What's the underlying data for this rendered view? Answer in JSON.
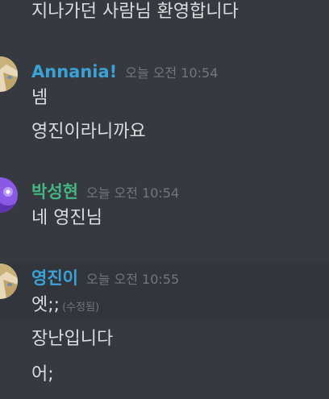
{
  "colors": {
    "background": "#36393f",
    "message_text": "#dcddde",
    "timestamp": "#72767d",
    "annania_name": "#3ba2d8",
    "park_name": "#43b581",
    "youngjin_name": "#3ba2d8"
  },
  "messages": {
    "top_line": "지나가던 사람님 환영합니다",
    "group1": {
      "username": "Annania!",
      "timestamp": "오늘 오전 10:54",
      "lines": [
        "넴",
        "영진이라니까요"
      ]
    },
    "group2": {
      "username": "박성현",
      "timestamp": "오늘 오전 10:54",
      "lines": [
        "네 영진님"
      ]
    },
    "group3": {
      "username": "영진이",
      "timestamp": "오늘 오전 10:55",
      "line1": "엣;;",
      "line1_edited": "(수정됨)",
      "line2": "장난입니다",
      "line3": "어;"
    }
  },
  "avatars": {
    "annania": "anime-girl-avatar-icon",
    "park": "purple-avatar-icon",
    "youngjin": "anime-girl-avatar-icon"
  }
}
